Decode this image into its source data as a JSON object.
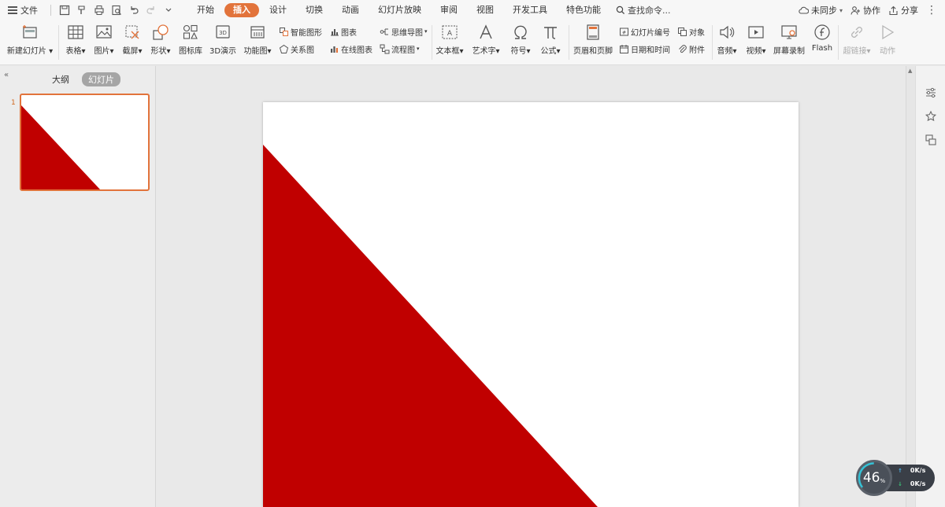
{
  "menubar": {
    "file_label": "文件",
    "tabs": [
      {
        "label": "开始"
      },
      {
        "label": "插入"
      },
      {
        "label": "设计"
      },
      {
        "label": "切换"
      },
      {
        "label": "动画"
      },
      {
        "label": "幻灯片放映"
      },
      {
        "label": "审阅"
      },
      {
        "label": "视图"
      },
      {
        "label": "开发工具"
      },
      {
        "label": "特色功能"
      }
    ],
    "active_tab": "插入",
    "search_label": "查找命令...",
    "sync_label": "未同步",
    "collab_label": "协作",
    "share_label": "分享"
  },
  "ribbon": {
    "new_slide": "新建幻灯片",
    "table": "表格",
    "picture": "图片",
    "screenshot": "截屏",
    "shape": "形状",
    "icon_lib": "图标库",
    "demo3d": "3D演示",
    "func_chart": "功能图",
    "smart_shape": "智能图形",
    "chart": "图表",
    "relation": "关系图",
    "online_chart": "在线图表",
    "mindmap": "思维导图",
    "flowchart": "流程图",
    "textbox": "文本框",
    "wordart": "艺术字",
    "symbol": "符号",
    "formula": "公式",
    "header_footer": "页眉和页脚",
    "slide_number": "幻灯片编号",
    "datetime": "日期和时间",
    "object": "对象",
    "attachment": "附件",
    "audio": "音频",
    "video": "视频",
    "screen_record": "屏幕录制",
    "flash": "Flash",
    "hyperlink": "超链接",
    "action": "动作"
  },
  "leftpane": {
    "tab_outline": "大纲",
    "tab_slides": "幻灯片",
    "slide_number": "1"
  },
  "speed_widget": {
    "percent": "46",
    "percent_unit": "%",
    "upload": "0K/s",
    "download": "0K/s"
  },
  "colors": {
    "accent": "#e2733b",
    "triangle_red": "#c00000"
  }
}
